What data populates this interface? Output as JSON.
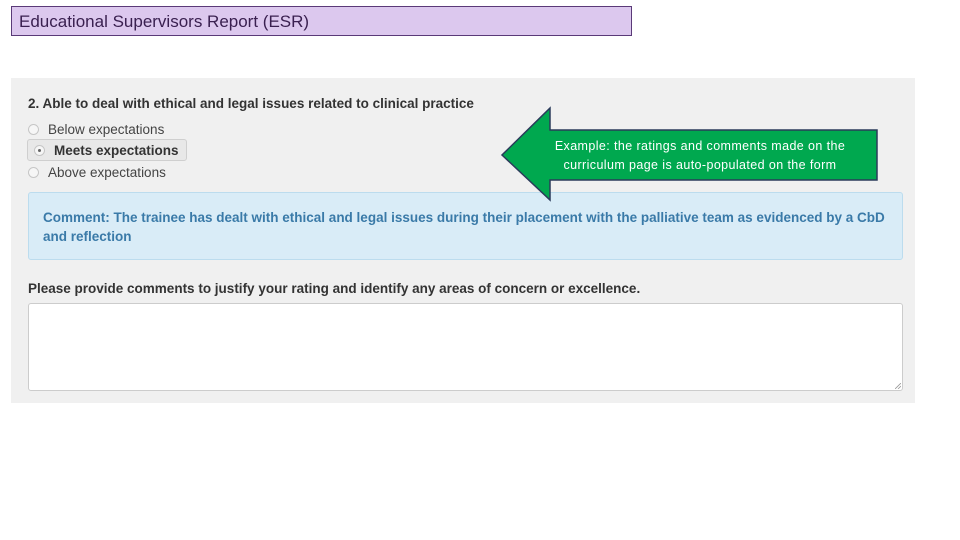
{
  "header": {
    "title": "Educational Supervisors Report (ESR)"
  },
  "form": {
    "question": "2. Able to deal with ethical and legal issues related to clinical practice",
    "options": [
      {
        "label": "Below expectations",
        "selected": false
      },
      {
        "label": "Meets expectations",
        "selected": true
      },
      {
        "label": "Above expectations",
        "selected": false
      }
    ],
    "comment": "Comment: The trainee has dealt with ethical and legal issues during their placement with the palliative team as evidenced by a CbD and reflection",
    "prompt": "Please provide comments to justify your rating and identify any areas of concern or excellence.",
    "textarea_value": ""
  },
  "callout": {
    "text": "Example: the ratings and comments made on the curriculum page is auto-populated on the form",
    "fill_color": "#00a84f",
    "border_color": "#2a3a5a"
  },
  "colors": {
    "header_bg": "#dcc8ee",
    "comment_bg": "#d9ecf7",
    "comment_text": "#3a7aa8"
  }
}
